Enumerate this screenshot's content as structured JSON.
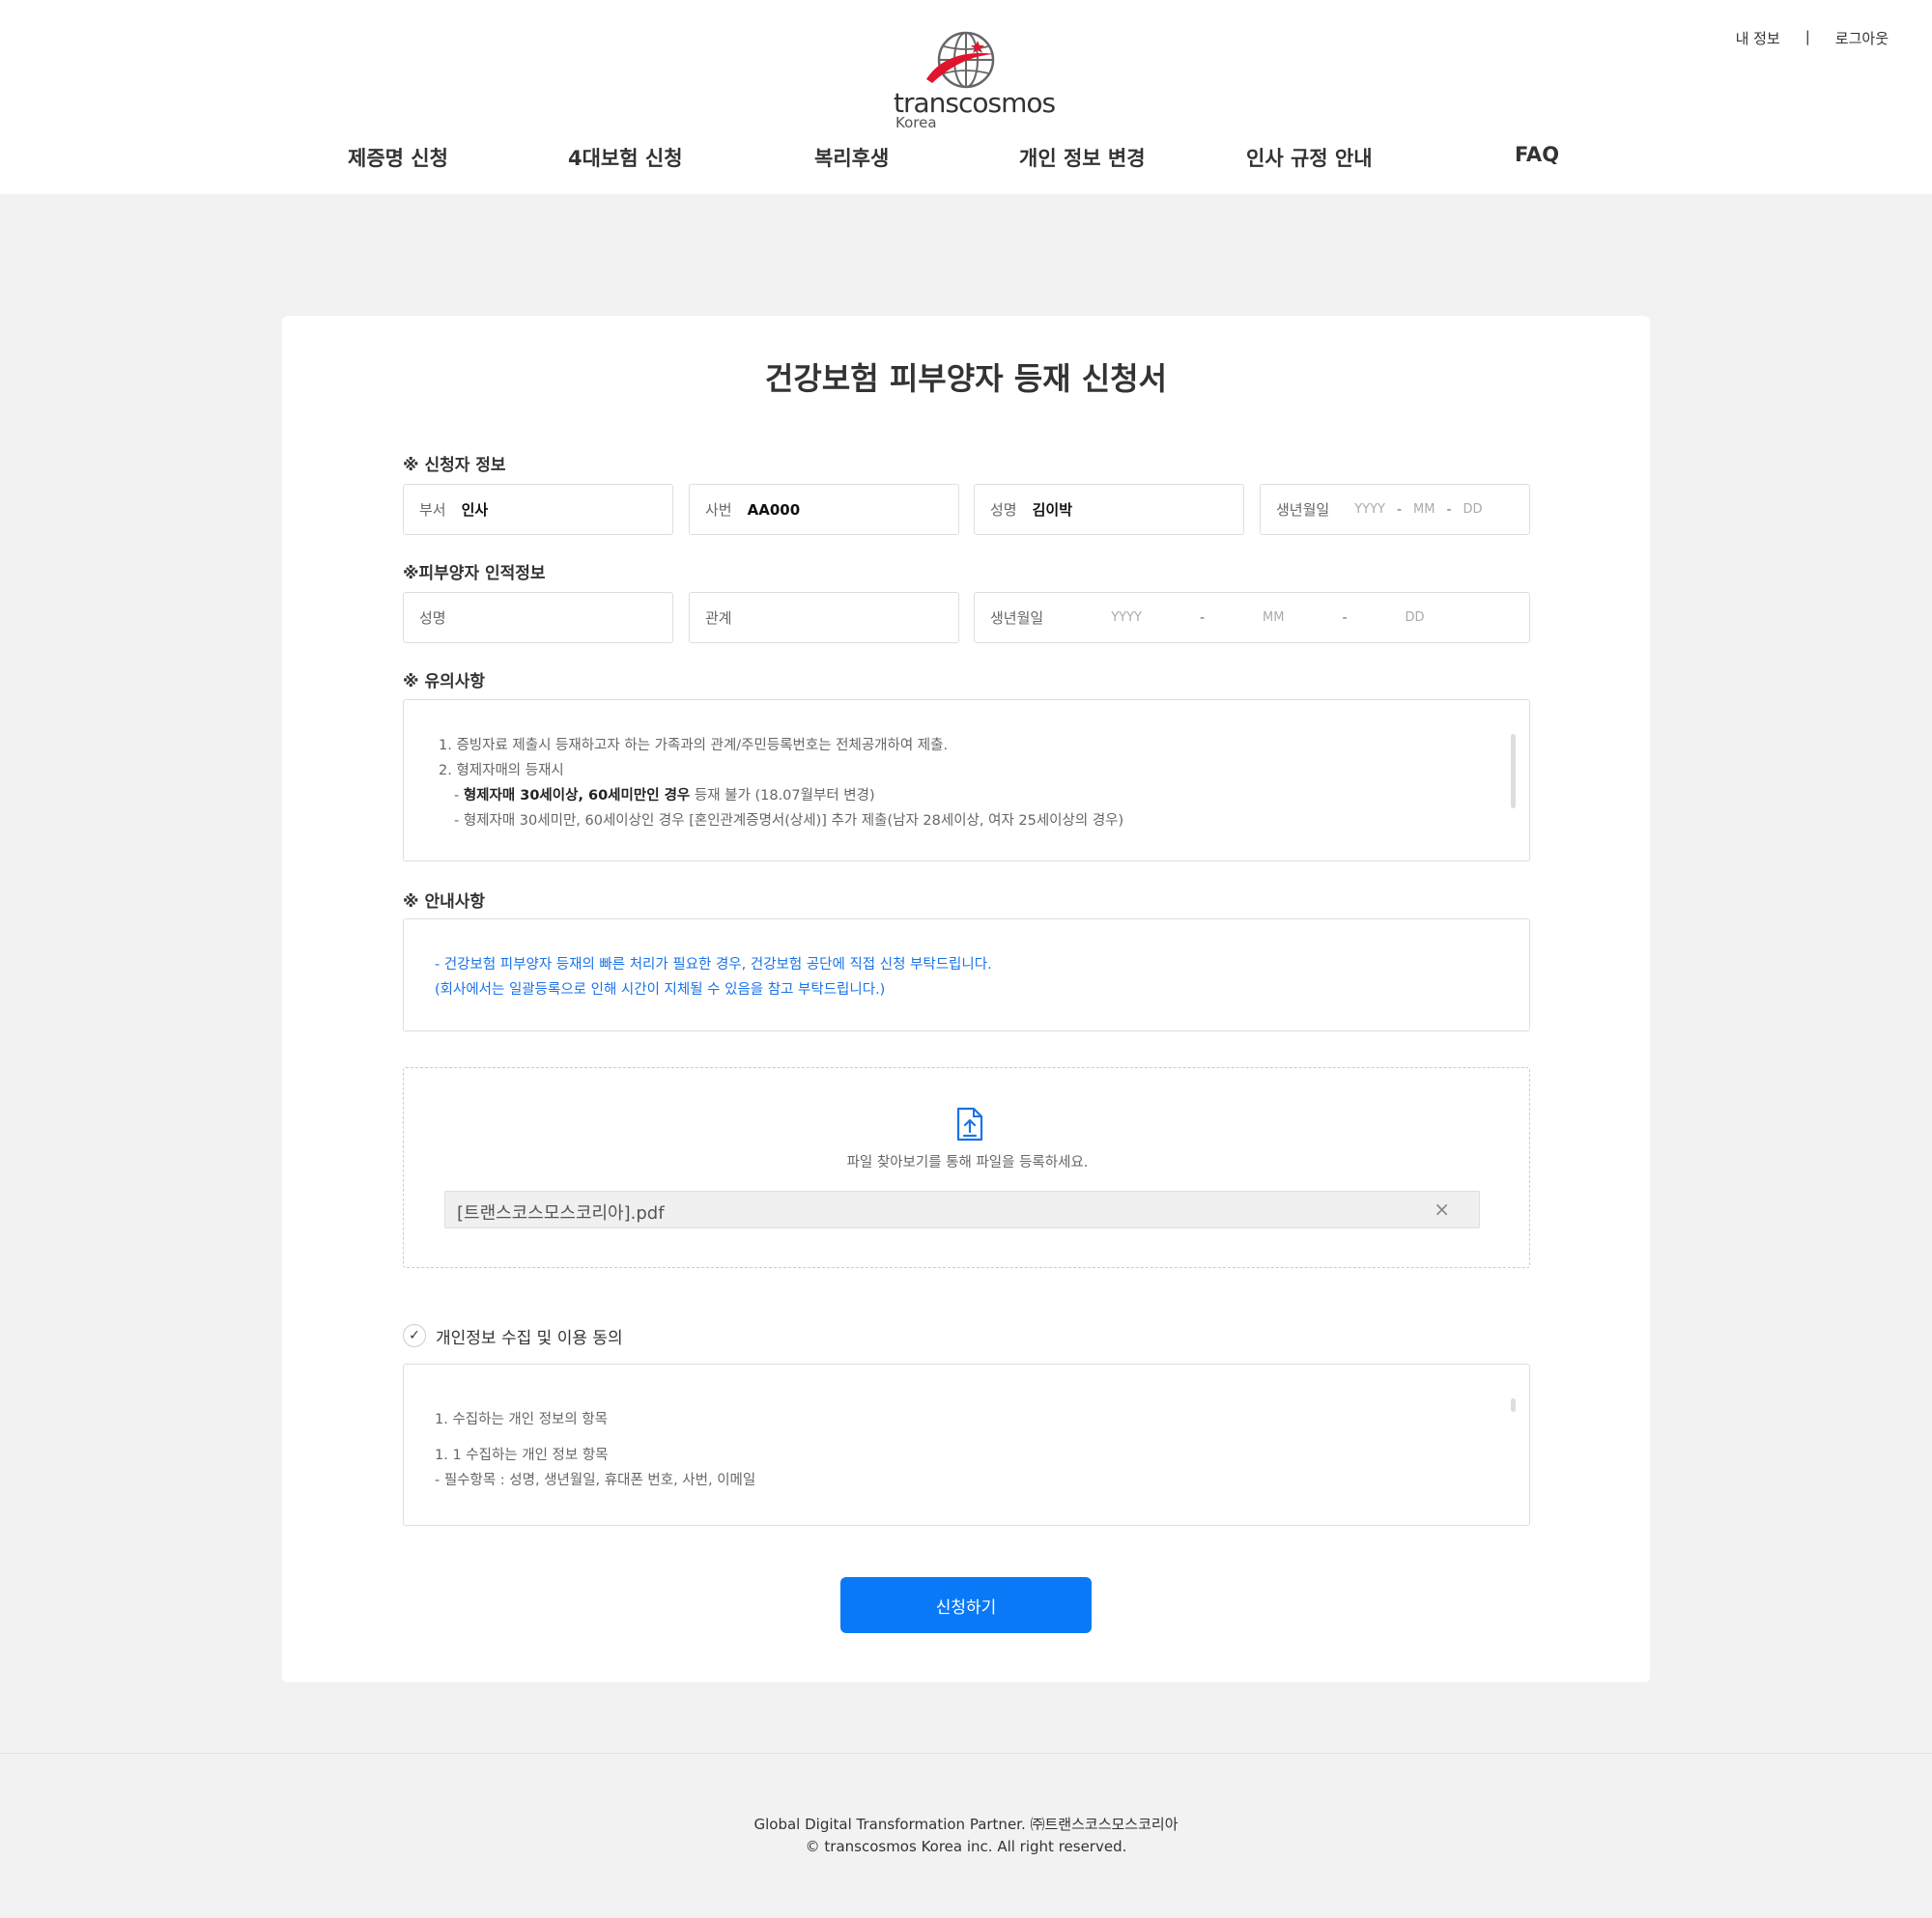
{
  "header": {
    "logo_text": "transcosmos",
    "logo_sub": "Korea",
    "util_my_info": "내 정보",
    "util_sep": "|",
    "util_logout": "로그아웃",
    "nav": [
      "제증명 신청",
      "4대보험 신청",
      "복리후생",
      "개인 정보 변경",
      "인사 규정 안내",
      "FAQ"
    ]
  },
  "main": {
    "title": "건강보험 피부양자 등재 신청서",
    "applicant": {
      "section_label": "※ 신청자 정보",
      "dept_label": "부서",
      "dept_value": "인사",
      "emp_no_label": "사번",
      "emp_no_value": "AA000",
      "name_label": "성명",
      "name_value": "김이박",
      "birth_label": "생년월일",
      "yyyy": "YYYY",
      "mm": "MM",
      "dd": "DD",
      "dash": "-"
    },
    "dependent": {
      "section_label": "※피부양자 인적정보",
      "name_placeholder": "성명",
      "relation_placeholder": "관계",
      "birth_label": "생년월일",
      "yyyy": "YYYY",
      "mm": "MM",
      "dd": "DD",
      "dash": "-"
    },
    "caution": {
      "section_label": "※ 유의사항",
      "line1": "1. 증빙자료 제출시 등재하고자 하는 가족과의 관계/주민등록번호는 전체공개하여 제출.",
      "line2": "2. 형제자매의 등재시",
      "line3_prefix": "- ",
      "line3_bold": "형제자매 30세이상, 60세미만인 경우",
      "line3_rest": " 등재 불가 (18.07월부터 변경)",
      "line4": "- 형제자매 30세미만, 60세이상인 경우 [혼인관계증명서(상세)] 추가 제출(남자 28세이상, 여자 25세이상의 경우)"
    },
    "guide": {
      "section_label": "※ 안내사항",
      "line1": "- 건강보험 피부양자 등재의 빠른 처리가 필요한 경우, 건강보험 공단에 직접 신청 부탁드립니다.",
      "line2": "(회사에서는 일괄등록으로 인해 시간이 지체될 수 있음을 참고 부탁드립니다.)"
    },
    "upload": {
      "icon": "file-upload-icon",
      "text": "파일 찾아보기를 통해 파일을 등록하세요.",
      "file_name": "[트랜스코스모스코리아].pdf",
      "remove_icon": "×"
    },
    "privacy": {
      "checked": true,
      "check_icon": "✓",
      "label": "개인정보 수집 및 이용 동의",
      "line1": "1. 수집하는 개인 정보의 항목",
      "line2": "1. 1 수집하는 개인 정보 항목",
      "line3": "- 필수항목 : 성명, 생년월일, 휴대폰 번호, 사번, 이메일"
    },
    "submit_label": "신청하기"
  },
  "footer": {
    "line1": "Global Digital Transformation Partner. ㈜트랜스코스모스코리아",
    "line2": "© transcosmos Korea inc. All right reserved."
  },
  "colors": {
    "accent": "#0a79f8",
    "guide_text": "#1a73e8",
    "logo_red": "#e0142d"
  }
}
